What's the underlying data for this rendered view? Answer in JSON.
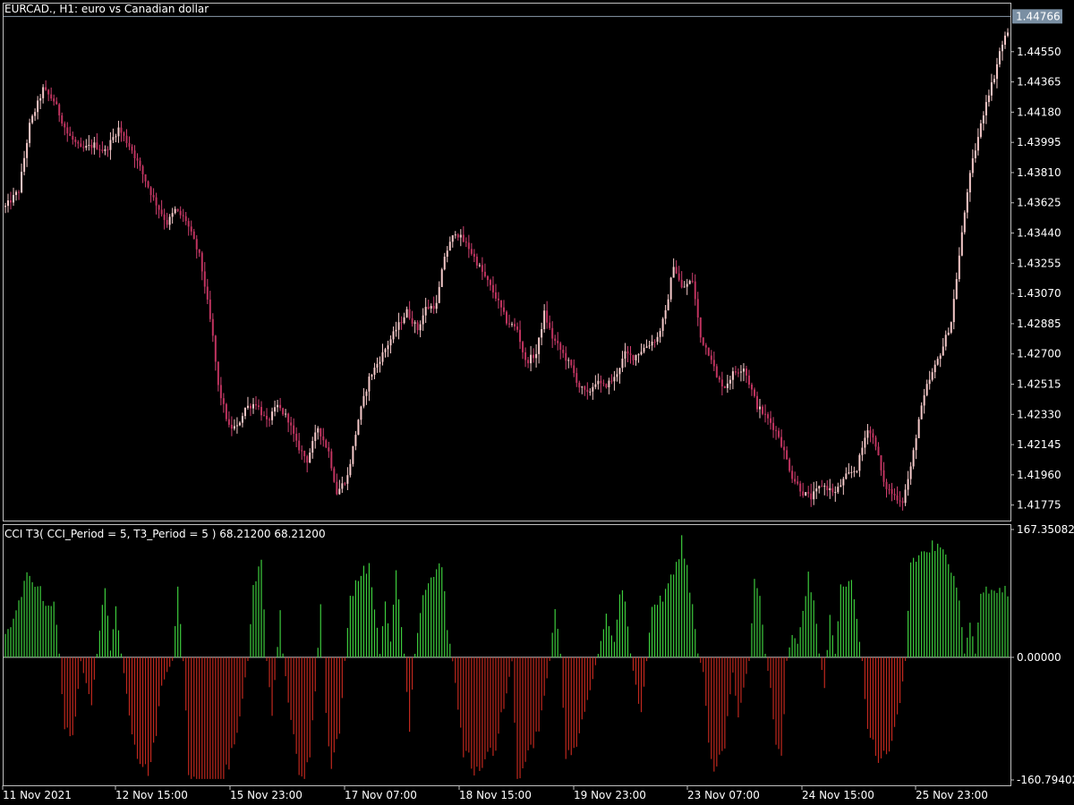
{
  "price_panel": {
    "header": "EURCAD., H1:  euro vs Canadian dollar",
    "current_price_label": "1.44766"
  },
  "cci_panel": {
    "header": "CCI T3( CCI_Period = 5, T3_Period = 5 ) 68.21200 68.21200",
    "max_label": "167.35082",
    "zero_label": "0.00000",
    "min_label": "-160.79402"
  },
  "colors": {
    "background": "#000000",
    "frame": "#c0c0c0",
    "bull_candle": "#f5c9c9",
    "bear_candle": "#c0335f",
    "wick": "#d04070",
    "cci_positive": "#3dcc3d",
    "cci_negative": "#c0281e",
    "last_price_bg": "#7a8fa3"
  },
  "chart_data": [
    {
      "type": "candlestick",
      "title": "EURCAD., H1:  euro vs Canadian dollar",
      "ylim": [
        1.4168,
        1.4485
      ],
      "y_ticks": [
        "1.44766",
        "1.44550",
        "1.44365",
        "1.44180",
        "1.43995",
        "1.43810",
        "1.43625",
        "1.43440",
        "1.43255",
        "1.43070",
        "1.42885",
        "1.42700",
        "1.42515",
        "1.42330",
        "1.42145",
        "1.41960",
        "1.41775"
      ],
      "x_ticks": [
        "11 Nov 2021",
        "12 Nov 15:00",
        "15 Nov 23:00",
        "17 Nov 07:00",
        "18 Nov 15:00",
        "19 Nov 23:00",
        "23 Nov 07:00",
        "24 Nov 15:00",
        "25 Nov 23:00"
      ],
      "last_price": 1.44766,
      "close_path": [
        [
          0,
          1.436
        ],
        [
          5,
          1.437
        ],
        [
          9,
          1.441
        ],
        [
          14,
          1.4432
        ],
        [
          18,
          1.4425
        ],
        [
          23,
          1.4405
        ],
        [
          28,
          1.4395
        ],
        [
          33,
          1.4398
        ],
        [
          37,
          1.4394
        ],
        [
          42,
          1.4408
        ],
        [
          47,
          1.4395
        ],
        [
          51,
          1.438
        ],
        [
          55,
          1.4365
        ],
        [
          60,
          1.435
        ],
        [
          63,
          1.4358
        ],
        [
          67,
          1.4352
        ],
        [
          72,
          1.433
        ],
        [
          74,
          1.4312
        ],
        [
          77,
          1.428
        ],
        [
          79,
          1.425
        ],
        [
          83,
          1.4225
        ],
        [
          86,
          1.4225
        ],
        [
          89,
          1.4237
        ],
        [
          93,
          1.424
        ],
        [
          97,
          1.4228
        ],
        [
          101,
          1.4238
        ],
        [
          105,
          1.423
        ],
        [
          108,
          1.4215
        ],
        [
          112,
          1.4205
        ],
        [
          116,
          1.4225
        ],
        [
          120,
          1.421
        ],
        [
          123,
          1.4185
        ],
        [
          127,
          1.4195
        ],
        [
          131,
          1.423
        ],
        [
          135,
          1.4255
        ],
        [
          140,
          1.427
        ],
        [
          145,
          1.4285
        ],
        [
          149,
          1.4296
        ],
        [
          153,
          1.4285
        ],
        [
          156,
          1.4298
        ],
        [
          160,
          1.43
        ],
        [
          163,
          1.433
        ],
        [
          167,
          1.4345
        ],
        [
          172,
          1.4335
        ],
        [
          177,
          1.432
        ],
        [
          182,
          1.4305
        ],
        [
          186,
          1.429
        ],
        [
          190,
          1.4285
        ],
        [
          193,
          1.4265
        ],
        [
          197,
          1.427
        ],
        [
          200,
          1.4295
        ],
        [
          203,
          1.428
        ],
        [
          207,
          1.427
        ],
        [
          210,
          1.4262
        ],
        [
          213,
          1.425
        ],
        [
          216,
          1.4245
        ],
        [
          219,
          1.4253
        ],
        [
          222,
          1.425
        ],
        [
          226,
          1.4255
        ],
        [
          230,
          1.427
        ],
        [
          233,
          1.4268
        ],
        [
          238,
          1.4275
        ],
        [
          242,
          1.428
        ],
        [
          245,
          1.4295
        ],
        [
          248,
          1.4325
        ],
        [
          251,
          1.431
        ],
        [
          255,
          1.4315
        ],
        [
          258,
          1.428
        ],
        [
          262,
          1.4268
        ],
        [
          264,
          1.4255
        ],
        [
          267,
          1.425
        ],
        [
          270,
          1.4258
        ],
        [
          274,
          1.4262
        ],
        [
          279,
          1.4238
        ],
        [
          284,
          1.4228
        ],
        [
          287,
          1.422
        ],
        [
          289,
          1.421
        ],
        [
          292,
          1.4195
        ],
        [
          296,
          1.4185
        ],
        [
          299,
          1.4182
        ],
        [
          303,
          1.419
        ],
        [
          308,
          1.4185
        ],
        [
          312,
          1.4195
        ],
        [
          316,
          1.42
        ],
        [
          320,
          1.4225
        ],
        [
          323,
          1.4215
        ],
        [
          326,
          1.419
        ],
        [
          330,
          1.4183
        ],
        [
          333,
          1.418
        ],
        [
          336,
          1.42
        ],
        [
          339,
          1.423
        ],
        [
          342,
          1.425
        ],
        [
          345,
          1.4262
        ],
        [
          348,
          1.4275
        ],
        [
          351,
          1.429
        ],
        [
          354,
          1.433
        ],
        [
          357,
          1.437
        ],
        [
          359,
          1.4388
        ],
        [
          362,
          1.441
        ],
        [
          364,
          1.4425
        ],
        [
          367,
          1.444
        ],
        [
          369,
          1.4455
        ],
        [
          372,
          1.4468
        ]
      ],
      "candles_count": 373
    },
    {
      "type": "histogram",
      "title": "CCI T3( CCI_Period = 5, T3_Period = 5 ) 68.21200 68.21200",
      "ylim": [
        -160.79402,
        167.35082
      ],
      "y_ticks": [
        "167.35082",
        "0.00000",
        "-160.79402"
      ],
      "value_path": [
        [
          0,
          30
        ],
        [
          1,
          36
        ],
        [
          4,
          60
        ],
        [
          8,
          110
        ],
        [
          12,
          100
        ],
        [
          14,
          80
        ],
        [
          16,
          70
        ],
        [
          18,
          78
        ],
        [
          20,
          5
        ],
        [
          22,
          -100
        ],
        [
          25,
          -110
        ],
        [
          28,
          -5
        ],
        [
          32,
          -70
        ],
        [
          34,
          5
        ],
        [
          37,
          100
        ],
        [
          39,
          10
        ],
        [
          41,
          65
        ],
        [
          43,
          5
        ],
        [
          46,
          -80
        ],
        [
          50,
          -150
        ],
        [
          53,
          -160
        ],
        [
          56,
          -100
        ],
        [
          58,
          -40
        ],
        [
          60,
          -20
        ],
        [
          62,
          -5
        ],
        [
          64,
          95
        ],
        [
          66,
          -5
        ],
        [
          68,
          -150
        ],
        [
          75,
          -210
        ],
        [
          80,
          -185
        ],
        [
          86,
          -100
        ],
        [
          90,
          -5
        ],
        [
          92,
          95
        ],
        [
          95,
          130
        ],
        [
          97,
          -5
        ],
        [
          99,
          -80
        ],
        [
          102,
          60
        ],
        [
          103,
          5
        ],
        [
          106,
          -90
        ],
        [
          109,
          -150
        ],
        [
          111,
          -160
        ],
        [
          113,
          -130
        ],
        [
          115,
          -50
        ],
        [
          117,
          78
        ],
        [
          119,
          -80
        ],
        [
          121,
          -160
        ],
        [
          124,
          -100
        ],
        [
          126,
          -5
        ],
        [
          128,
          80
        ],
        [
          132,
          120
        ],
        [
          135,
          125
        ],
        [
          137,
          70
        ],
        [
          139,
          5
        ],
        [
          141,
          80
        ],
        [
          143,
          20
        ],
        [
          145,
          115
        ],
        [
          148,
          5
        ],
        [
          150,
          -100
        ],
        [
          152,
          5
        ],
        [
          155,
          90
        ],
        [
          159,
          115
        ],
        [
          162,
          130
        ],
        [
          164,
          40
        ],
        [
          166,
          -5
        ],
        [
          170,
          -130
        ],
        [
          174,
          -150
        ],
        [
          178,
          -140
        ],
        [
          182,
          -120
        ],
        [
          184,
          -80
        ],
        [
          186,
          -50
        ],
        [
          188,
          -5
        ],
        [
          190,
          -160
        ],
        [
          194,
          -130
        ],
        [
          198,
          -100
        ],
        [
          202,
          -5
        ],
        [
          204,
          70
        ],
        [
          206,
          5
        ],
        [
          208,
          -140
        ],
        [
          212,
          -120
        ],
        [
          216,
          -60
        ],
        [
          220,
          5
        ],
        [
          223,
          55
        ],
        [
          226,
          20
        ],
        [
          228,
          90
        ],
        [
          230,
          80
        ],
        [
          232,
          5
        ],
        [
          234,
          -40
        ],
        [
          236,
          -80
        ],
        [
          238,
          -5
        ],
        [
          240,
          70
        ],
        [
          244,
          80
        ],
        [
          248,
          115
        ],
        [
          251,
          160
        ],
        [
          253,
          120
        ],
        [
          255,
          70
        ],
        [
          257,
          5
        ],
        [
          259,
          -20
        ],
        [
          261,
          -110
        ],
        [
          263,
          -150
        ],
        [
          267,
          -120
        ],
        [
          270,
          -20
        ],
        [
          272,
          -80
        ],
        [
          274,
          -40
        ],
        [
          276,
          -5
        ],
        [
          278,
          100
        ],
        [
          280,
          80
        ],
        [
          282,
          5
        ],
        [
          284,
          -40
        ],
        [
          286,
          -120
        ],
        [
          288,
          -140
        ],
        [
          290,
          -5
        ],
        [
          292,
          30
        ],
        [
          294,
          20
        ],
        [
          296,
          60
        ],
        [
          298,
          110
        ],
        [
          300,
          80
        ],
        [
          302,
          5
        ],
        [
          304,
          -40
        ],
        [
          306,
          60
        ],
        [
          308,
          5
        ],
        [
          310,
          100
        ],
        [
          314,
          100
        ],
        [
          316,
          50
        ],
        [
          318,
          -5
        ],
        [
          320,
          -100
        ],
        [
          324,
          -140
        ],
        [
          328,
          -120
        ],
        [
          332,
          -60
        ],
        [
          334,
          -5
        ],
        [
          336,
          130
        ],
        [
          340,
          140
        ],
        [
          344,
          150
        ],
        [
          348,
          140
        ],
        [
          352,
          120
        ],
        [
          354,
          80
        ],
        [
          356,
          5
        ],
        [
          358,
          50
        ],
        [
          360,
          5
        ],
        [
          362,
          90
        ]
      ]
    }
  ]
}
